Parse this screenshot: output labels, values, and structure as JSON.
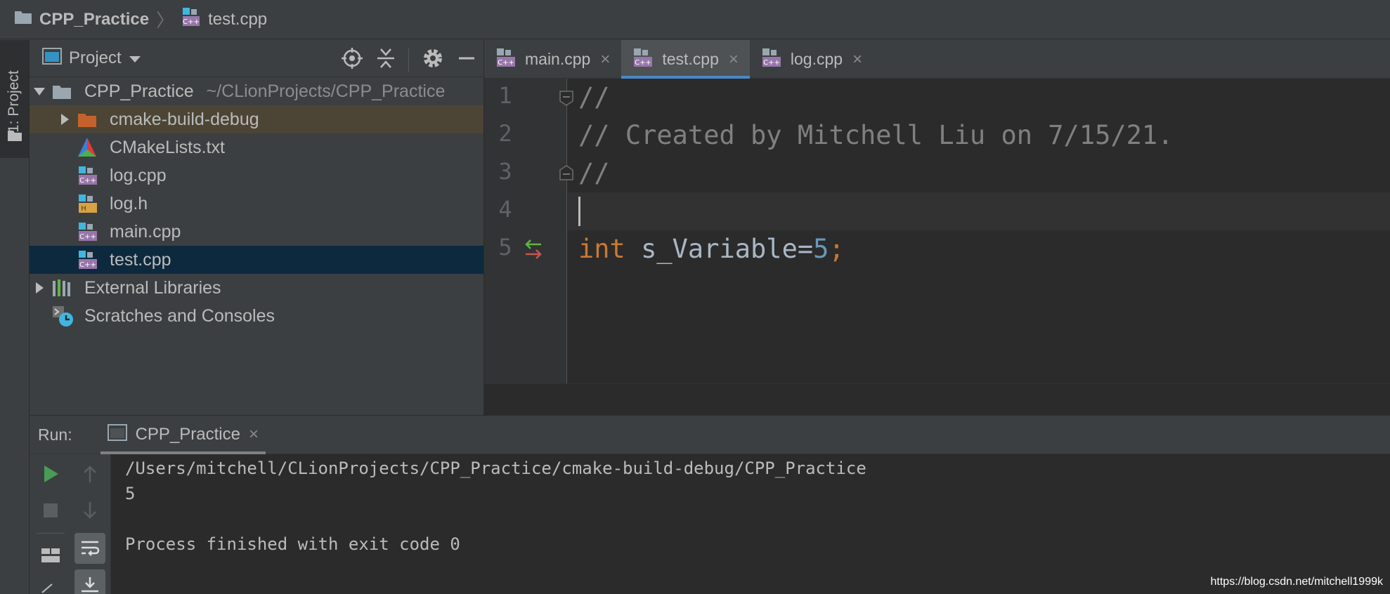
{
  "breadcrumb": {
    "project": "CPP_Practice",
    "file": "test.cpp",
    "separator": "〉"
  },
  "tool_stripe": {
    "project_tab": "1: Project"
  },
  "project_panel": {
    "title": "Project",
    "tree": [
      {
        "label": "CPP_Practice",
        "path": "~/CLionProjects/CPP_Practice",
        "icon": "folder-icon",
        "expanded": true
      },
      {
        "label": "cmake-build-debug",
        "icon": "orange-folder-icon",
        "expanded": false
      },
      {
        "label": "CMakeLists.txt",
        "icon": "cmake-icon"
      },
      {
        "label": "log.cpp",
        "icon": "cpp-file-icon"
      },
      {
        "label": "log.h",
        "icon": "header-file-icon"
      },
      {
        "label": "main.cpp",
        "icon": "cpp-file-icon"
      },
      {
        "label": "test.cpp",
        "icon": "cpp-file-icon",
        "selected": true
      },
      {
        "label": "External Libraries",
        "icon": "libraries-icon",
        "expanded": false
      },
      {
        "label": "Scratches and Consoles",
        "icon": "scratches-icon"
      }
    ]
  },
  "editor_tabs": [
    {
      "label": "main.cpp",
      "close": "×",
      "active": false
    },
    {
      "label": "test.cpp",
      "close": "×",
      "active": true
    },
    {
      "label": "log.cpp",
      "close": "×",
      "active": false
    }
  ],
  "editor": {
    "line_numbers": [
      "1",
      "2",
      "3",
      "4",
      "5"
    ],
    "lines": {
      "l1": "//",
      "l2": "// Created by Mitchell Liu on 7/15/21.",
      "l3": "//",
      "l5_kw": "int",
      "l5_id": " s_Variable=",
      "l5_num": "5",
      "l5_end": ";"
    }
  },
  "run_panel": {
    "label": "Run:",
    "tab": "CPP_Practice",
    "close": "×",
    "console": [
      "/Users/mitchell/CLionProjects/CPP_Practice/cmake-build-debug/CPP_Practice",
      "5",
      "",
      "Process finished with exit code 0"
    ]
  },
  "watermark": "https://blog.csdn.net/mitchell1999k",
  "colors": {
    "background": "#3c3f41",
    "editor_bg": "#2b2b2b",
    "keyword": "#cc7832",
    "number": "#6897bb",
    "comment": "#808080",
    "selection": "#0d293e",
    "accent": "#4a88c7"
  }
}
